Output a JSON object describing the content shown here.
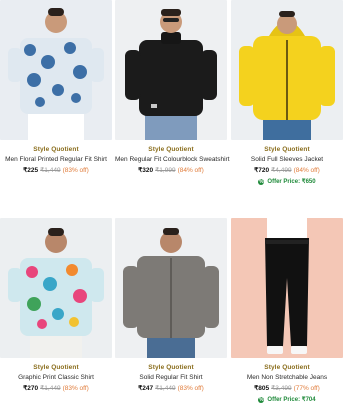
{
  "products": [
    {
      "brand": "Style Quotient",
      "title": "Men Floral Printed Regular Fit Shirt",
      "price": "₹225",
      "mrp": "₹1,449",
      "discount": "(83% off)",
      "offer": ""
    },
    {
      "brand": "Style Quotient",
      "title": "Men Regular Fit Colourblock Sweatshirt",
      "price": "₹320",
      "mrp": "₹1,999",
      "discount": "(84% off)",
      "offer": ""
    },
    {
      "brand": "Style Quotient",
      "title": "Solid Full Sleeves Jacket",
      "price": "₹720",
      "mrp": "₹4,499",
      "discount": "(84% off)",
      "offer": "Offer Price: ₹650"
    },
    {
      "brand": "Style Quotient",
      "title": "Graphic Print Classic Shirt",
      "price": "₹270",
      "mrp": "₹1,449",
      "discount": "(83% off)",
      "offer": ""
    },
    {
      "brand": "Style Quotient",
      "title": "Solid Regular Fit Shirt",
      "price": "₹247",
      "mrp": "₹1,449",
      "discount": "(83% off)",
      "offer": ""
    },
    {
      "brand": "Style Quotient",
      "title": "Men Non Stretchable Jeans",
      "price": "₹805",
      "mrp": "₹3,499",
      "discount": "(77% off)",
      "offer": "Offer Price: ₹704"
    }
  ],
  "colors": {
    "brand_text": "#8a6d1c",
    "discount": "#e07b39",
    "offer_green": "#1f8a3a"
  }
}
